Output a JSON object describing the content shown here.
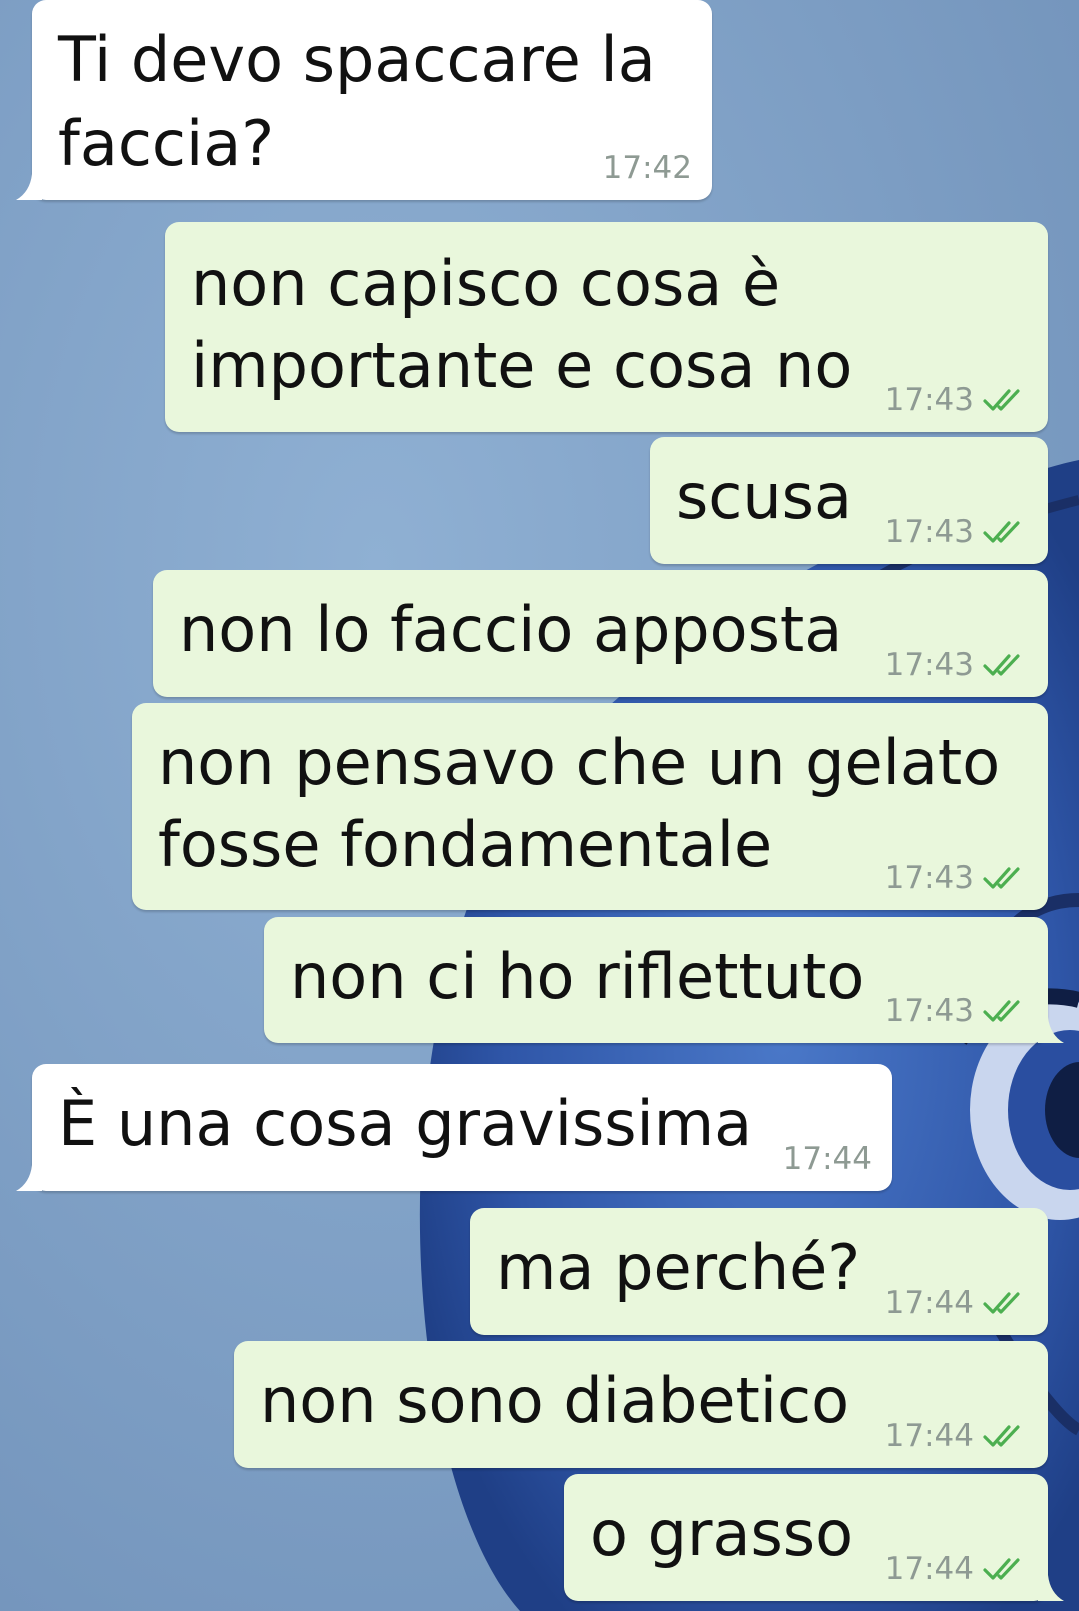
{
  "colors": {
    "wallpaper": "#7fa0c4",
    "incoming_bubble": "#ffffff",
    "outgoing_bubble": "#e9f7dc",
    "read_ticks": "#4caf50"
  },
  "messages": [
    {
      "direction": "in",
      "lines": [
        "Ti devo spaccare la",
        "faccia?"
      ],
      "time": "17:42"
    },
    {
      "direction": "out",
      "lines": [
        "non capisco cosa è",
        "importante e cosa no"
      ],
      "time": "17:43",
      "status": "read-ticks-icon"
    },
    {
      "direction": "out",
      "lines": [
        "scusa"
      ],
      "time": "17:43",
      "status": "read-ticks-icon"
    },
    {
      "direction": "out",
      "lines": [
        "non lo faccio apposta"
      ],
      "time": "17:43",
      "status": "read-ticks-icon"
    },
    {
      "direction": "out",
      "lines": [
        "non pensavo che un gelato",
        "fosse fondamentale"
      ],
      "time": "17:43",
      "status": "read-ticks-icon"
    },
    {
      "direction": "out",
      "lines": [
        "non ci ho riflettuto"
      ],
      "time": "17:43",
      "status": "read-ticks-icon"
    },
    {
      "direction": "in",
      "lines": [
        "È una cosa gravissima"
      ],
      "time": "17:44"
    },
    {
      "direction": "out",
      "lines": [
        "ma perché?"
      ],
      "time": "17:44",
      "status": "read-ticks-icon"
    },
    {
      "direction": "out",
      "lines": [
        "non sono diabetico"
      ],
      "time": "17:44",
      "status": "read-ticks-icon"
    },
    {
      "direction": "out",
      "lines": [
        "o grasso"
      ],
      "time": "17:44",
      "status": "read-ticks-icon"
    }
  ]
}
